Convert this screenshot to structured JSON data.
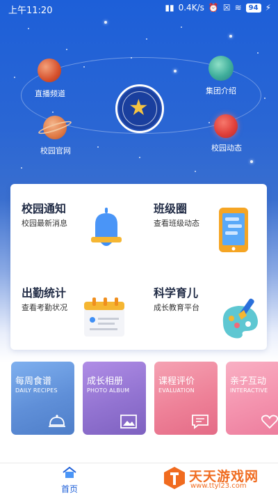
{
  "status_bar": {
    "time": "上午11:20",
    "network_speed": "0.4K/s",
    "battery": "94"
  },
  "hero": {
    "planets": [
      {
        "id": "live",
        "label": "直播频道"
      },
      {
        "id": "group",
        "label": "集团介绍"
      },
      {
        "id": "website",
        "label": "校园官网"
      },
      {
        "id": "news",
        "label": "校园动态"
      }
    ]
  },
  "features": [
    {
      "title": "校园通知",
      "subtitle": "校园最新消息",
      "icon": "bell-icon"
    },
    {
      "title": "班级圈",
      "subtitle": "查看班级动态",
      "icon": "phone-icon"
    },
    {
      "title": "出勤统计",
      "subtitle": "查看考勤状况",
      "icon": "calendar-icon"
    },
    {
      "title": "科学育儿",
      "subtitle": "成长教育平台",
      "icon": "palette-icon"
    }
  ],
  "tiles": [
    {
      "title": "每周食谱",
      "subtitle": "DAILY RECIPES",
      "color": "#6a9de0",
      "icon": "dish-icon"
    },
    {
      "title": "成长相册",
      "subtitle": "PHOTO ALBUM",
      "color": "#9a78d6",
      "icon": "image-icon"
    },
    {
      "title": "课程评价",
      "subtitle": "EVALUATION",
      "color": "#ef8aa0",
      "icon": "comment-icon"
    },
    {
      "title": "亲子互动",
      "subtitle": "INTERACTIVE",
      "color": "#f59bb5",
      "icon": "heart-icon"
    }
  ],
  "nav": {
    "home_label": "首页"
  },
  "watermark": {
    "text": "天天游戏网",
    "url": "www.ttyl23.com"
  }
}
